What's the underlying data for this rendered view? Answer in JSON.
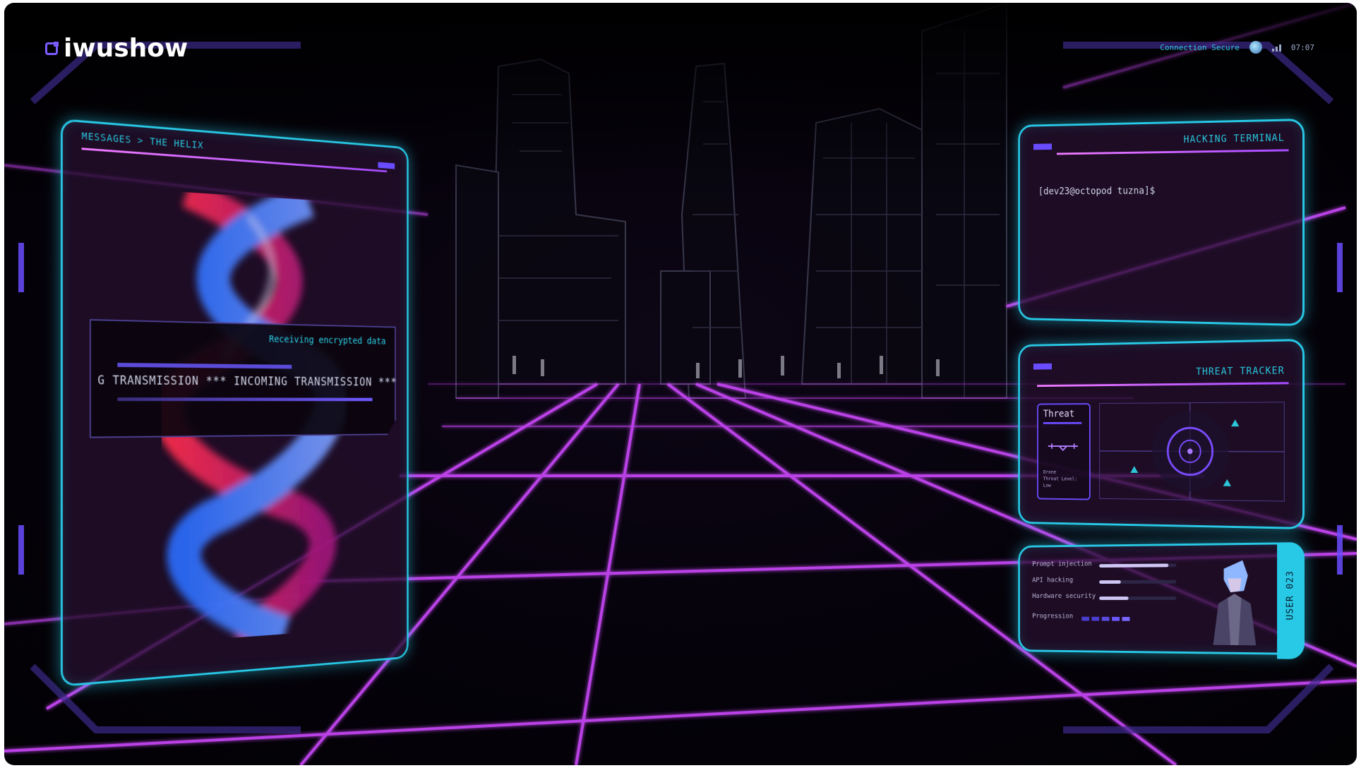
{
  "brand": {
    "name": "iwushow",
    "logo_icon": "brand-logo-icon"
  },
  "status": {
    "connection": "Connection Secure",
    "time": "07:07"
  },
  "messages_panel": {
    "breadcrumb": "MESSAGES > THE HELIX",
    "receiving_label": "Receiving encrypted data",
    "ticker": "G TRANSMISSION  ***  INCOMING TRANSMISSION  ***"
  },
  "terminal_panel": {
    "title": "HACKING TERMINAL",
    "prompt": "[dev23@octopod tuzna]$"
  },
  "threat_panel": {
    "title": "THREAT TRACKER",
    "card_name": "Threat",
    "card_meta": "Drone\nThreat Level:\nLow"
  },
  "profile_panel": {
    "user_label": "USER 023",
    "skills": [
      {
        "label": "Prompt injection",
        "level": 0.9
      },
      {
        "label": "API hacking",
        "level": 0.28
      },
      {
        "label": "Hardware security",
        "level": 0.38
      }
    ],
    "progression_label": "Progression"
  },
  "colors": {
    "accent_cyan": "#28c9e6",
    "grid_magenta": "#d24bff",
    "hud_violet": "#6a4cff"
  }
}
